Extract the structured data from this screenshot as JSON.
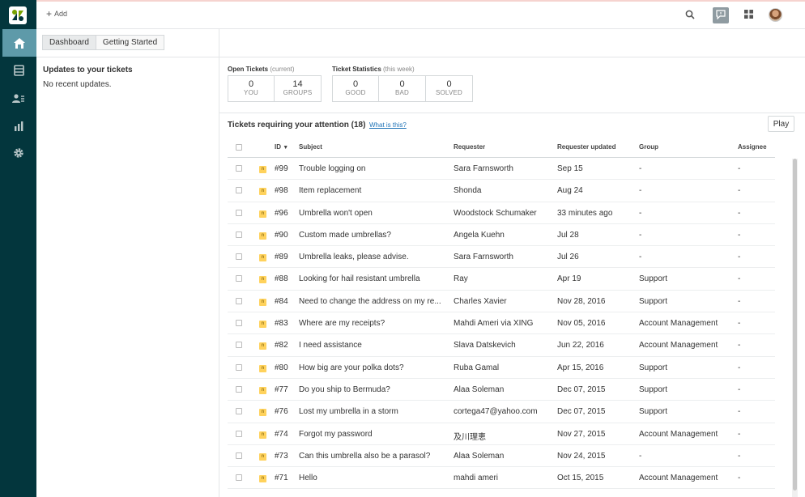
{
  "topbar": {
    "add_label": "Add"
  },
  "left": {
    "tabs": [
      {
        "label": "Dashboard"
      },
      {
        "label": "Getting Started"
      }
    ],
    "updates_title": "Updates to your tickets",
    "updates_empty": "No recent updates."
  },
  "stats": {
    "open": {
      "title": "Open Tickets",
      "sub": "(current)",
      "boxes": [
        {
          "value": "0",
          "label": "YOU"
        },
        {
          "value": "14",
          "label": "GROUPS"
        }
      ]
    },
    "ticket_stats": {
      "title": "Ticket Statistics",
      "sub": "(this week)",
      "boxes": [
        {
          "value": "0",
          "label": "GOOD"
        },
        {
          "value": "0",
          "label": "BAD"
        },
        {
          "value": "0",
          "label": "SOLVED"
        }
      ]
    }
  },
  "attention": {
    "title": "Tickets requiring your attention (18)",
    "link": "What is this?",
    "play": "Play"
  },
  "table": {
    "columns": {
      "id": "ID",
      "sort_glyph": "▼",
      "subject": "Subject",
      "requester": "Requester",
      "updated": "Requester updated",
      "group": "Group",
      "assignee": "Assignee"
    },
    "status_letter": "n",
    "rows": [
      {
        "id": "#99",
        "subject": "Trouble logging on",
        "requester": "Sara Farnsworth",
        "updated": "Sep 15",
        "group": "-",
        "assignee": "-"
      },
      {
        "id": "#98",
        "subject": "Item replacement",
        "requester": "Shonda",
        "updated": "Aug 24",
        "group": "-",
        "assignee": "-"
      },
      {
        "id": "#96",
        "subject": "Umbrella won't open",
        "requester": "Woodstock Schumaker",
        "updated": "33 minutes ago",
        "group": "-",
        "assignee": "-"
      },
      {
        "id": "#90",
        "subject": "Custom made umbrellas?",
        "requester": "Angela Kuehn",
        "updated": "Jul 28",
        "group": "-",
        "assignee": "-"
      },
      {
        "id": "#89",
        "subject": "Umbrella leaks, please advise.",
        "requester": "Sara Farnsworth",
        "updated": "Jul 26",
        "group": "-",
        "assignee": "-"
      },
      {
        "id": "#88",
        "subject": "Looking for hail resistant umbrella",
        "requester": "Ray",
        "updated": "Apr 19",
        "group": "Support",
        "assignee": "-"
      },
      {
        "id": "#84",
        "subject": "Need to change the address on my re...",
        "requester": "Charles Xavier",
        "updated": "Nov 28, 2016",
        "group": "Support",
        "assignee": "-"
      },
      {
        "id": "#83",
        "subject": "Where are my receipts?",
        "requester": "Mahdi Ameri via XING",
        "updated": "Nov 05, 2016",
        "group": "Account Management",
        "assignee": "-"
      },
      {
        "id": "#82",
        "subject": "I need assistance",
        "requester": "Slava Datskevich",
        "updated": "Jun 22, 2016",
        "group": "Account Management",
        "assignee": "-"
      },
      {
        "id": "#80",
        "subject": "How big are your polka dots?",
        "requester": "Ruba Gamal",
        "updated": "Apr 15, 2016",
        "group": "Support",
        "assignee": "-"
      },
      {
        "id": "#77",
        "subject": "Do you ship to Bermuda?",
        "requester": "Alaa Soleman",
        "updated": "Dec 07, 2015",
        "group": "Support",
        "assignee": "-"
      },
      {
        "id": "#76",
        "subject": "Lost my umbrella in a storm",
        "requester": "cortega47@yahoo.com",
        "updated": "Dec 07, 2015",
        "group": "Support",
        "assignee": "-"
      },
      {
        "id": "#74",
        "subject": "Forgot my password",
        "requester": "及川理恵",
        "updated": "Nov 27, 2015",
        "group": "Account Management",
        "assignee": "-"
      },
      {
        "id": "#73",
        "subject": "Can this umbrella also be a parasol?",
        "requester": "Alaa Soleman",
        "updated": "Nov 24, 2015",
        "group": "-",
        "assignee": "-"
      },
      {
        "id": "#71",
        "subject": "Hello",
        "requester": "mahdi ameri",
        "updated": "Oct 15, 2015",
        "group": "Account Management",
        "assignee": "-"
      }
    ]
  },
  "colors": {
    "sidebar": "#03363d",
    "sidebar_active": "#5e9aa9",
    "link": "#1f73b7",
    "status_new": "#ffd25c"
  },
  "icons": {
    "logo": "zendesk-logo",
    "nav": [
      "home-icon",
      "views-icon",
      "customers-icon",
      "reporting-icon",
      "admin-gear-icon"
    ],
    "top": [
      "search-icon",
      "chat-icon",
      "product-tray-icon",
      "user-avatar"
    ]
  }
}
